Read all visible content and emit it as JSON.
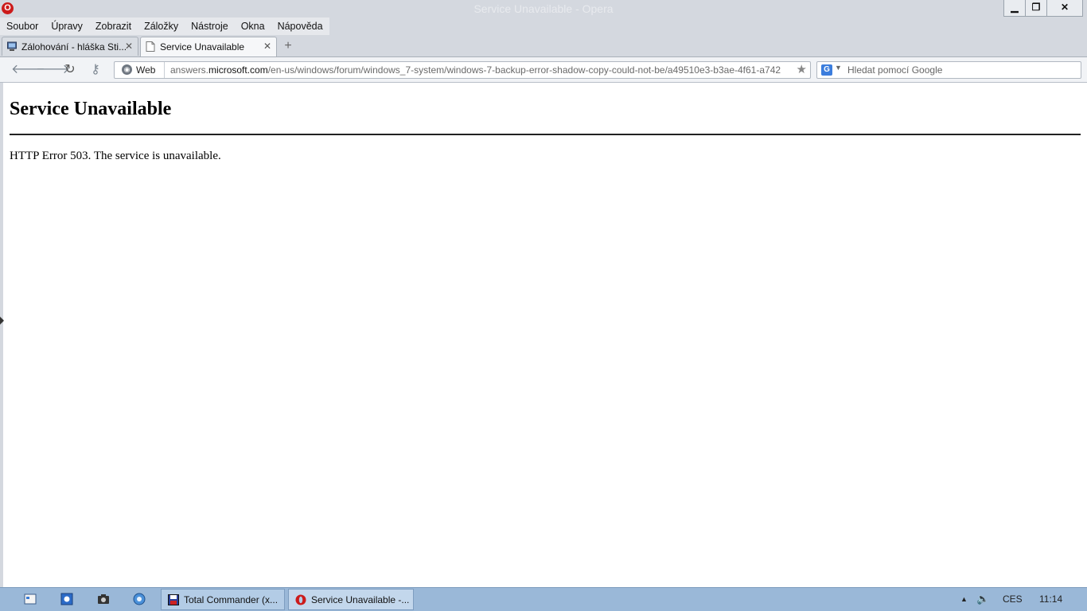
{
  "window": {
    "title": "Service Unavailable - Opera",
    "logo": "O"
  },
  "win_buttons": {
    "minimize": "▁",
    "restore": "❐",
    "close": "✕"
  },
  "menu": [
    "Soubor",
    "Úpravy",
    "Zobrazit",
    "Záložky",
    "Nástroje",
    "Okna",
    "Nápověda"
  ],
  "tabs": [
    {
      "label": "Zálohování - hláška Sti...",
      "icon": "computer-icon",
      "active": false
    },
    {
      "label": "Service Unavailable",
      "icon": "page-icon",
      "active": true
    }
  ],
  "tab_close": "✕",
  "new_tab": "+",
  "nav": {
    "back": "🡐",
    "forward": "🡒",
    "reload": "↻",
    "key": "⚷"
  },
  "address": {
    "mode_label": "Web",
    "url_prefix": "answers.",
    "url_domain": "microsoft.com",
    "url_path": "/en-us/windows/forum/windows_7-system/windows-7-backup-error-shadow-copy-could-not-be/a49510e3-b3ae-4f61-a742"
  },
  "search": {
    "placeholder": "Hledat pomocí Google",
    "engine_letter": "G"
  },
  "page": {
    "heading": "Service Unavailable",
    "message": "HTTP Error 503. The service is unavailable."
  },
  "taskbar": {
    "items": [
      {
        "label": "Total Commander (x...",
        "icon": "floppy-icon"
      },
      {
        "label": "Service Unavailable -...",
        "icon": "opera-icon"
      }
    ],
    "tray": {
      "language": "CES",
      "time": "11:14"
    }
  },
  "colors": {
    "opera_red": "#cc1b1b",
    "taskbar": "#9ab8d8",
    "chrome": "#d4d8df"
  }
}
